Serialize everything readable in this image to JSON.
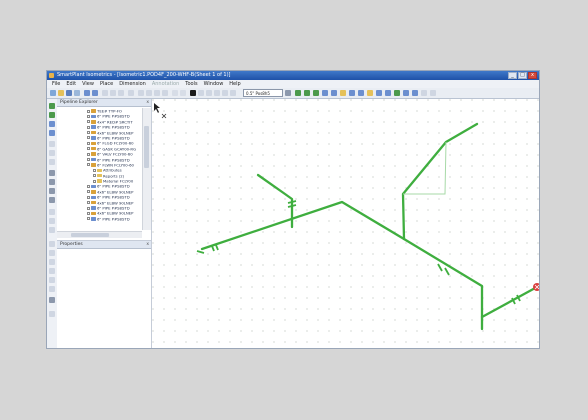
{
  "app": {
    "title": "SmartPlant Isometrics - [Isometric1.POD4F_200-WHF-B(Sheet 1 of 1)]",
    "window_controls": [
      "_",
      "□",
      "x"
    ]
  },
  "menu": {
    "items": [
      {
        "label": "File",
        "enabled": true
      },
      {
        "label": "Edit",
        "enabled": true
      },
      {
        "label": "View",
        "enabled": true
      },
      {
        "label": "Place",
        "enabled": true
      },
      {
        "label": "Dimension",
        "enabled": true
      },
      {
        "label": "Annotation",
        "enabled": false
      },
      {
        "label": "Tools",
        "enabled": true
      },
      {
        "label": "Window",
        "enabled": true
      },
      {
        "label": "Help",
        "enabled": true
      }
    ]
  },
  "toolbar": {
    "size_combo": "0.5\" Pos8h5"
  },
  "pipeline_explorer": {
    "title": "Pipeline Explorer",
    "close": "x",
    "items": [
      {
        "label": "TEE# TYP-FO",
        "icon": "tee"
      },
      {
        "label": "6\" PIPE P#S8STD",
        "icon": "pipe"
      },
      {
        "label": "4x4\" RED# SRCTIT",
        "icon": "reducer"
      },
      {
        "label": "6\" PIPE P#S8STD",
        "icon": "pipe"
      },
      {
        "label": "4x6\" ELBW 90LNEP",
        "icon": "elbow"
      },
      {
        "label": "6\" PIPE P#S8STD",
        "icon": "pipe"
      },
      {
        "label": "6\" FLGD FCLY00-60",
        "icon": "flange"
      },
      {
        "label": "6\" GASK GCAY00-RG",
        "icon": "gasket"
      },
      {
        "label": "6\" VALV FCLY00-60",
        "icon": "valve"
      },
      {
        "label": "6\" PIPE P#S8STD",
        "icon": "pipe"
      },
      {
        "label": "6\" FLWN FCLY00-60",
        "icon": "flange"
      },
      {
        "label": "Attributes",
        "icon": "folder"
      },
      {
        "label": "Reports (2)",
        "icon": "folder"
      },
      {
        "label": "Material FCLY00",
        "icon": "folder"
      },
      {
        "label": "6\" PIPE P#S8STD",
        "icon": "pipe"
      },
      {
        "label": "4x6\" ELBW 90LNEP",
        "icon": "elbow"
      },
      {
        "label": "6\" PIPE P#S8STD",
        "icon": "pipe"
      },
      {
        "label": "4x6\" ELBW 90LNEP",
        "icon": "elbow"
      },
      {
        "label": "6\" PIPE P#S8STD",
        "icon": "pipe"
      },
      {
        "label": "4x6\" ELBW 90LNEP",
        "icon": "elbow"
      },
      {
        "label": "6\" PIPE P#S8STD",
        "icon": "pipe"
      }
    ]
  },
  "properties_panel": {
    "title": "Properties",
    "close": "x"
  },
  "colors": {
    "pipe": "#3fae3f",
    "pipe_dark": "#2b8d2b",
    "end_marker": "#d94040",
    "titlebar": "#1f52a8"
  }
}
